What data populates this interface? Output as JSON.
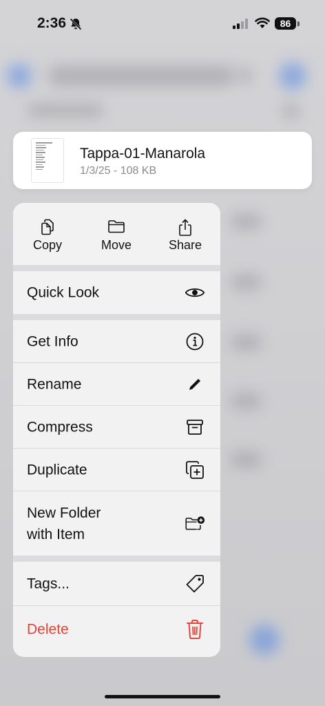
{
  "status_bar": {
    "time": "2:36",
    "battery": "86"
  },
  "file": {
    "name": "Tappa-01-Manarola",
    "meta": "1/3/25 - 108 KB"
  },
  "quick_actions": [
    {
      "label": "Copy",
      "icon": "copy-icon"
    },
    {
      "label": "Move",
      "icon": "folder-icon"
    },
    {
      "label": "Share",
      "icon": "share-icon"
    }
  ],
  "menu": {
    "quick_look": "Quick Look",
    "get_info": "Get Info",
    "rename": "Rename",
    "compress": "Compress",
    "duplicate": "Duplicate",
    "new_folder_line1": "New Folder",
    "new_folder_line2": "with Item",
    "tags": "Tags...",
    "delete": "Delete"
  },
  "colors": {
    "destructive": "#e5443a",
    "text": "#111111",
    "secondary": "#8a8a8e"
  }
}
